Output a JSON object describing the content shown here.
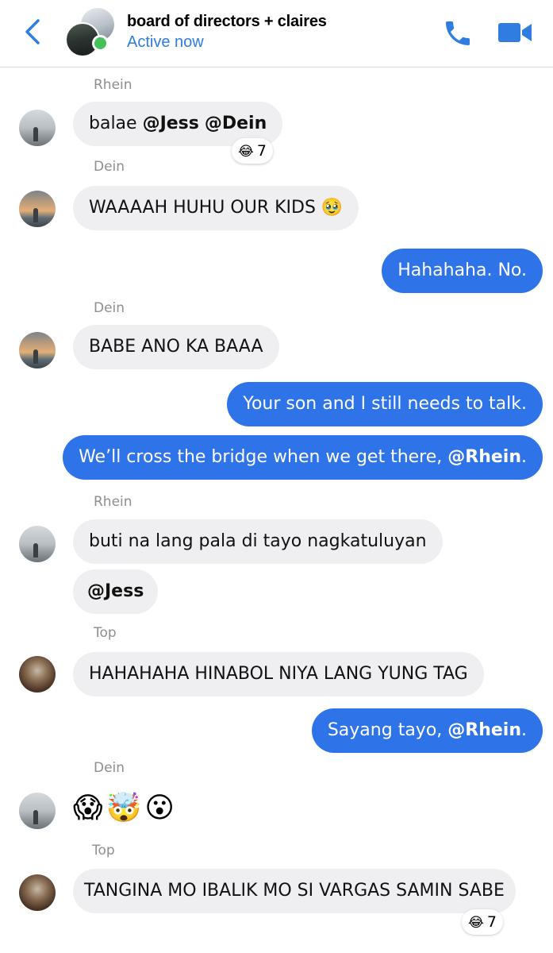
{
  "header": {
    "title": "board of directors + claires",
    "status": "Active now",
    "icons": {
      "back": "chevron-left-icon",
      "call": "phone-icon",
      "video": "video-camera-icon"
    },
    "accent_color": "#2f7de1",
    "online_color": "#44c25a"
  },
  "messages": {
    "m1": {
      "sender": "Rhein",
      "text_pre": "balae ",
      "mention_1": "@Jess",
      "space": " ",
      "mention_2": "@Dein",
      "reaction_emoji": "😂",
      "reaction_count": "7"
    },
    "m2": {
      "sender": "Dein",
      "text": "WAAAAH HUHU OUR KIDS 🥹"
    },
    "m3": {
      "text": "Hahahaha. No."
    },
    "m4": {
      "sender": "Dein",
      "text": "BABE ANO KA BAAA"
    },
    "m5": {
      "text": "Your son and I still needs to talk."
    },
    "m6": {
      "text_pre": "We’ll cross the bridge when we get there, ",
      "mention": "@Rhein",
      "text_post": "."
    },
    "m7": {
      "sender": "Rhein",
      "text": "buti na lang pala di tayo nagkatuluyan"
    },
    "m8": {
      "mention": "@Jess"
    },
    "m9": {
      "sender": "Top",
      "text": "HAHAHAHA HINABOL NIYA LANG YUNG TAG"
    },
    "m10": {
      "text_pre": "Sayang tayo, ",
      "mention": "@Rhein",
      "text_post": "."
    },
    "m11": {
      "sender": "Dein",
      "emojis": "😱🤯😮"
    },
    "m12": {
      "sender": "Top",
      "text": "TANGINA MO IBALIK MO SI VARGAS SAMIN SABE",
      "reaction_emoji": "😂",
      "reaction_count": "7"
    }
  },
  "colors": {
    "incoming_bubble": "#efeff1",
    "outgoing_bubble": "#2f73e8",
    "sender_label": "#8e8e93"
  }
}
